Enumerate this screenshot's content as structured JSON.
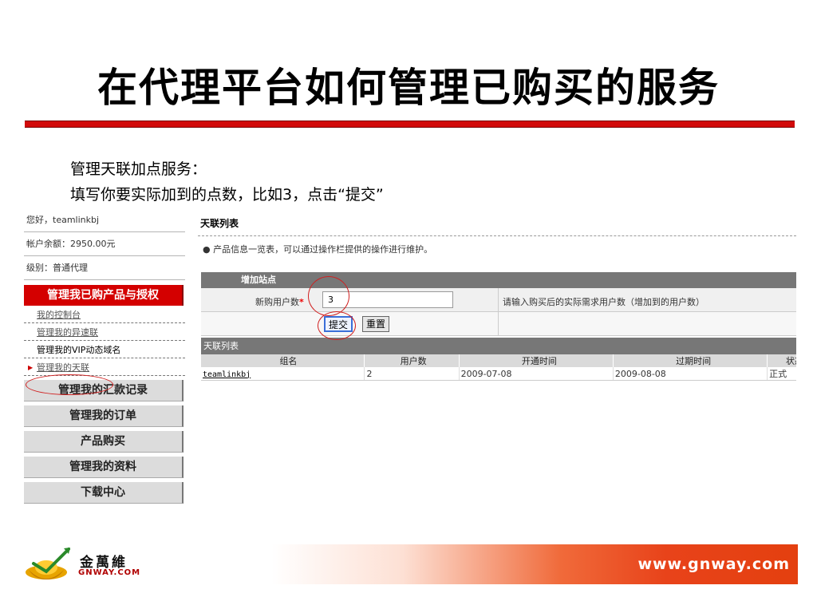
{
  "slide": {
    "title": "在代理平台如何管理已购买的服务",
    "intro_line1": "管理天联加点服务：",
    "intro_line2": "填写你要实际加到的点数，比如3，点击“提交”"
  },
  "sidebar": {
    "greeting": "您好，teamlinkbj",
    "balance": "帐户余额：2950.00元",
    "level": "级别：普通代理",
    "active_menu": "管理我已购产品与授权",
    "sub_items": [
      "我的控制台",
      "管理我的异速联",
      "管理我的VIP动态域名",
      "管理我的天联"
    ],
    "menus": [
      "管理我的汇款记录",
      "管理我的订单",
      "产品购买",
      "管理我的资料",
      "下载中心"
    ]
  },
  "main": {
    "title": "天联列表",
    "note": "● 产品信息一览表，可以通过操作栏提供的操作进行维护。",
    "form": {
      "header": "增加站点",
      "field_label": "新购用户数",
      "required_mark": "*",
      "field_value": "3",
      "hint": "请输入购买后的实际需求用户数（增加到的用户数）",
      "submit_label": "提交",
      "reset_label": "重置"
    },
    "list": {
      "header": "天联列表",
      "columns": [
        "组名",
        "用户数",
        "开通时间",
        "过期时间",
        "状态"
      ],
      "rows": [
        [
          "teamlinkbj",
          "2",
          "2009-07-08",
          "2009-08-08",
          "正式"
        ]
      ]
    }
  },
  "footer": {
    "logo_cn": "金萬維",
    "logo_en": "GNWAY.COM",
    "url": "www.gnway.com"
  },
  "colors": {
    "accent_red": "#d20a0a",
    "menu_red": "#d40000",
    "header_gray": "#777777",
    "footer_orange": "#e4400f"
  }
}
